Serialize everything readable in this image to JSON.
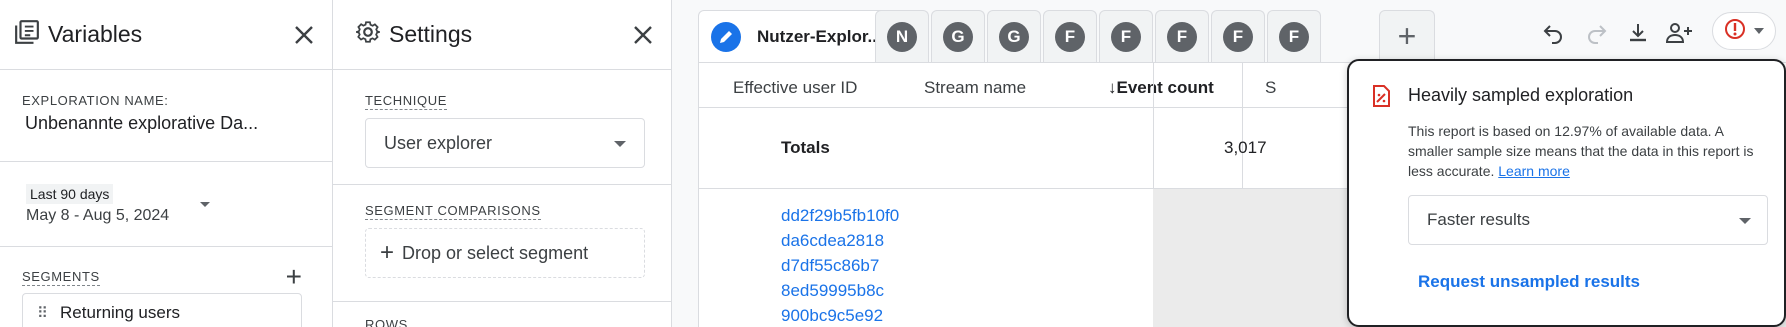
{
  "variables": {
    "title": "Variables",
    "exploration_name_label": "EXPLORATION NAME:",
    "exploration_name_value": "Unbenannte explorative Da...",
    "date_chip": "Last 90 days",
    "date_range": "May 8 - Aug 5, 2024",
    "segments_label": "SEGMENTS",
    "segment_item": "Returning users"
  },
  "settings": {
    "title": "Settings",
    "technique_label": "TECHNIQUE",
    "technique_value": "User explorer",
    "segment_comparisons_label": "SEGMENT COMPARISONS",
    "drop_segment": "Drop or select segment",
    "rows_label": "ROWS"
  },
  "tabs": {
    "active": "Nutzer-Explor...",
    "others": [
      "N",
      "G",
      "G",
      "F",
      "F",
      "F",
      "F",
      "F"
    ],
    "add": "+"
  },
  "table": {
    "columns": [
      "Effective user ID",
      "Stream name",
      "Event count",
      "S"
    ],
    "sort_indicator": "↓",
    "totals_label": "Totals",
    "totals_value": "3,017",
    "user_ids": [
      "dd2f29b5fb10f0",
      "da6cdea2818",
      "d7df55c86b7",
      "8ed59995b8c",
      "900bc9c5e92"
    ]
  },
  "popover": {
    "title": "Heavily sampled exploration",
    "description": "This report is based on 12.97% of available data. A smaller sample size means that the data in this report is less accurate.",
    "learn_more": "Learn more",
    "dropdown_value": "Faster results",
    "request_link": "Request unsampled results"
  },
  "colors": {
    "accent": "#1a73e8",
    "alert_red": "#d93025",
    "avatar_gray": "#5f6368"
  }
}
